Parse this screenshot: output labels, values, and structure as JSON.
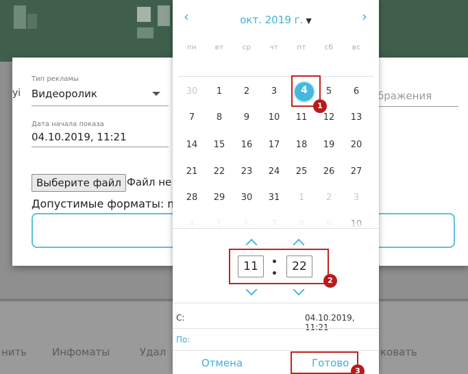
{
  "background": {
    "actions": [
      "нить",
      "Инфоматы",
      "Удал",
      "ковать"
    ]
  },
  "modal": {
    "left_cut_text": "уі",
    "ad_type": {
      "label": "Тип рекламы",
      "value": "Видеоролик"
    },
    "start_date": {
      "label": "Дата начала показа",
      "value": "04.10.2019, 11:21"
    },
    "right_field_text": "бражения",
    "file": {
      "button_label": "Выберите файл",
      "status": "Файл не"
    },
    "formats_text": "Допустимые форматы: m"
  },
  "picker": {
    "month_label": "окт. 2019 г.",
    "prev_symbol": "‹",
    "next_symbol": "›",
    "weekdays": [
      "пн",
      "вт",
      "ср",
      "чт",
      "пт",
      "сб",
      "вс"
    ],
    "weeks": [
      [
        "30",
        "1",
        "2",
        "3",
        "4",
        "5",
        "6"
      ],
      [
        "7",
        "8",
        "9",
        "10",
        "11",
        "12",
        "13"
      ],
      [
        "14",
        "15",
        "16",
        "17",
        "18",
        "19",
        "20"
      ],
      [
        "21",
        "22",
        "23",
        "24",
        "25",
        "26",
        "27"
      ],
      [
        "28",
        "29",
        "30",
        "31",
        "1",
        "2",
        "3"
      ],
      [
        "4",
        "5",
        "6",
        "7",
        "8",
        "9",
        "10"
      ]
    ],
    "selected_day": "4",
    "hour": "11",
    "minute": "22",
    "from_label": "С:",
    "from_value": "04.10.2019, 11:21",
    "to_label": "По:",
    "cancel_label": "Отмена",
    "done_label": "Готово"
  },
  "annotations": [
    "1",
    "2",
    "3"
  ],
  "colors": {
    "accent": "#45b8dd",
    "annotation": "#c41f1f",
    "header": "#3f5f4c"
  }
}
